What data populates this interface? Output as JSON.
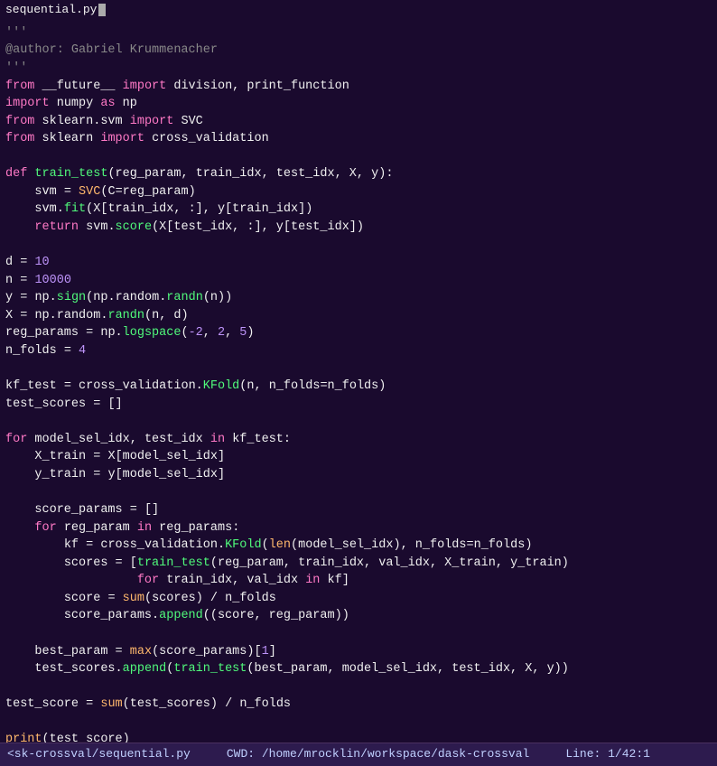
{
  "title_bar": {
    "filename": "sequential.py",
    "cursor_visible": true
  },
  "status_bar": {
    "file": "<sk-crossval/sequential.py",
    "cwd": "CWD: /home/mrocklin/workspace/dask-crossval",
    "line": "Line: 1/42:1"
  },
  "code": {
    "lines": [
      "'''\n@author: Gabriel Krummenacher\n'''",
      "from __future__ import division, print_function\nimport numpy as np\nfrom sklearn.svm import SVC\nfrom sklearn import cross_validation\n",
      "\ndef train_test(reg_param, train_idx, test_idx, X, y):\n    svm = SVC(C=reg_param)\n    svm.fit(X[train_idx, :], y[train_idx])\n    return svm.score(X[test_idx, :], y[test_idx])\n",
      "\nd = 10\nn = 10000\ny = np.sign(np.random.randn(n))\nX = np.random.randn(n, d)\nreg_params = np.logspace(-2, 2, 5)\nn_folds = 4\n",
      "\nkf_test = cross_validation.KFold(n, n_folds=n_folds)\ntest_scores = []\n",
      "\nfor model_sel_idx, test_idx in kf_test:\n    X_train = X[model_sel_idx]\n    y_train = y[model_sel_idx]\n",
      "\n    score_params = []\n    for reg_param in reg_params:\n        kf = cross_validation.KFold(len(model_sel_idx), n_folds=n_folds)\n        scores = [train_test(reg_param, train_idx, val_idx, X_train, y_train)\n                  for train_idx, val_idx in kf]\n        score = sum(scores) / n_folds\n        score_params.append((score, reg_param))\n",
      "\n    best_param = max(score_params)[1]\n    test_scores.append(train_test(best_param, model_sel_idx, test_idx, X, y))\n",
      "\ntest_score = sum(test_scores) / n_folds\n",
      "\nprint(test_score)\n~"
    ]
  }
}
